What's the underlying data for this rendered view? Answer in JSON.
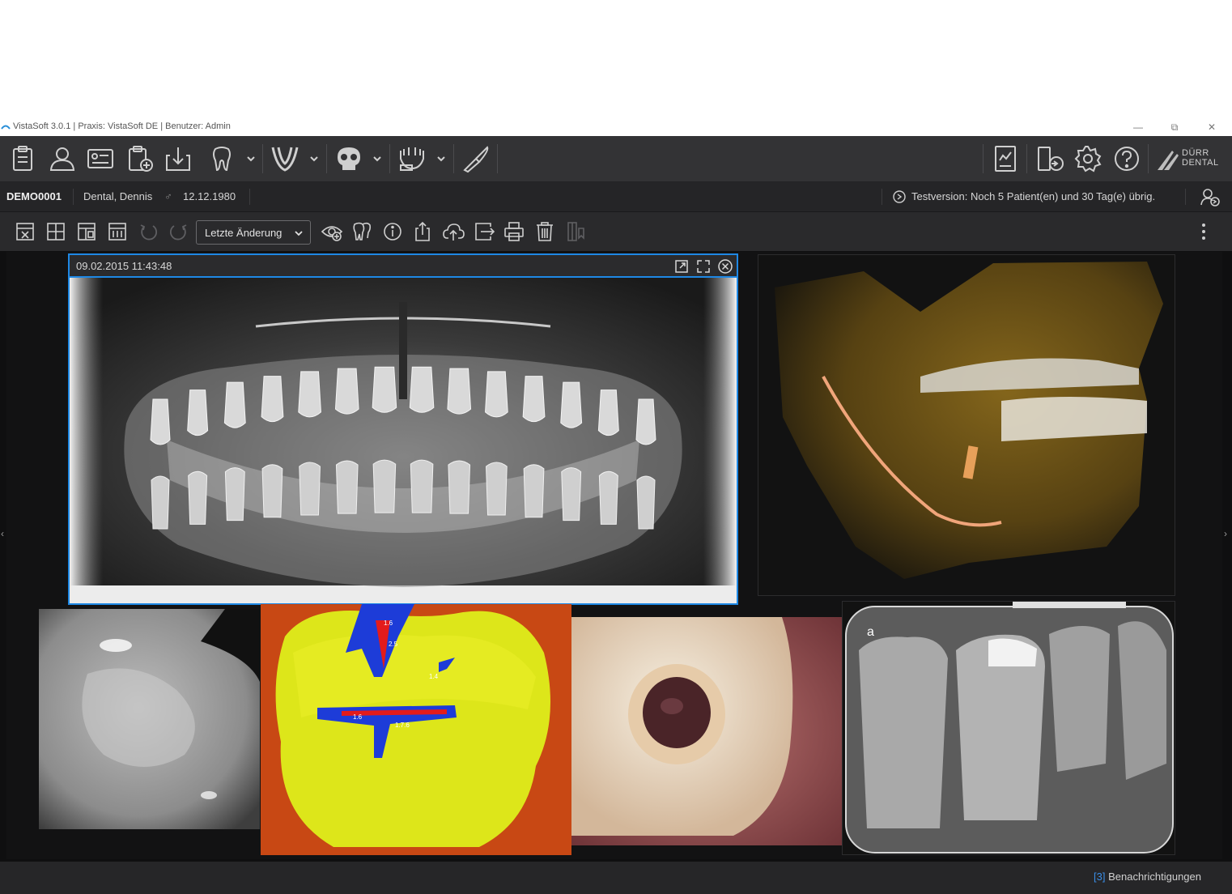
{
  "window": {
    "title": "VistaSoft 3.0.1 | Praxis: VistaSoft DE | Benutzer: Admin",
    "controls": {
      "minimize": "—",
      "restore": "⧉",
      "close": "✕"
    }
  },
  "toolbar": {
    "icons": [
      "clipboard-icon",
      "patient-icon",
      "patient-card-icon",
      "add-record-icon",
      "import-icon",
      "tooth-icon",
      "jaw-arch-icon",
      "skull-icon",
      "dental-model-icon",
      "scalpel-icon"
    ],
    "right_icons": [
      "report-icon",
      "export-device-icon",
      "gear-icon",
      "help-icon"
    ],
    "brand": {
      "line1": "DÜRR",
      "line2": "DENTAL"
    }
  },
  "patient": {
    "id": "DEMO0001",
    "name": "Dental, Dennis",
    "gender_symbol": "♂",
    "birthdate": "12.12.1980",
    "trial_notice": "Testversion: Noch 5 Patient(en) und 30 Tag(e) übrig."
  },
  "viewer_toolbar": {
    "sort_label": "Letzte Änderung",
    "icons": [
      "single-view-icon",
      "grid-view-icon",
      "layout-icon",
      "compare-icon",
      "undo-icon",
      "redo-icon",
      "view-icon",
      "tooth-chart-icon",
      "info-icon",
      "export-icon",
      "upload-cloud-icon",
      "forward-icon",
      "print-icon",
      "delete-icon",
      "bookmark-icon",
      "more-icon"
    ]
  },
  "images": {
    "selected_timestamp": "09.02.2015 11:43:48",
    "tiles": [
      {
        "name": "panoramic-xray"
      },
      {
        "name": "3d-volume-render"
      },
      {
        "name": "intraoral-grayscale"
      },
      {
        "name": "caries-detection-map",
        "labels": [
          "1.6",
          "2.5",
          "1.4",
          "1.6",
          "1.7.6"
        ]
      },
      {
        "name": "intraoral-photo"
      },
      {
        "name": "bitewing-xray",
        "marker": "a"
      }
    ]
  },
  "footer": {
    "notification_count": "[3]",
    "notification_label": "Benachrichtigungen"
  },
  "colors": {
    "accent": "#1e88e5",
    "toolbar_bg": "#333335",
    "content_bg": "#121213"
  }
}
